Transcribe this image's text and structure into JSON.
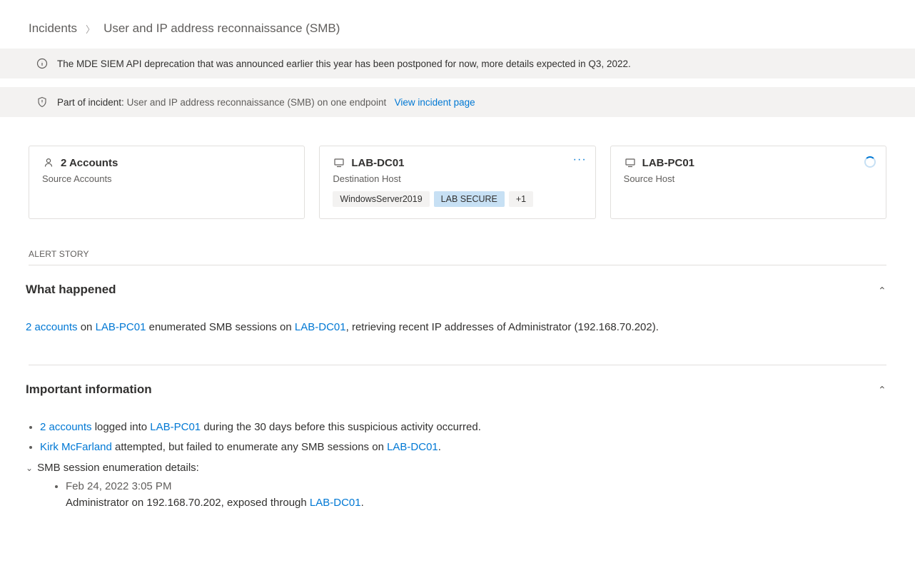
{
  "breadcrumb": {
    "root": "Incidents",
    "current": "User and IP address reconnaissance (SMB)"
  },
  "banners": {
    "deprecation": "The MDE SIEM API deprecation that was announced earlier this year has been postponed for now, more details expected in Q3, 2022.",
    "incident_prefix": "Part of incident:",
    "incident_text": "User and IP address reconnaissance (SMB) on one endpoint",
    "incident_link": "View incident page"
  },
  "cards": {
    "accounts": {
      "title": "2 Accounts",
      "subtitle": "Source Accounts"
    },
    "dest": {
      "title": "LAB-DC01",
      "subtitle": "Destination Host",
      "tag1": "WindowsServer2019",
      "tag2": "LAB SECURE",
      "tag3": "+1"
    },
    "source": {
      "title": "LAB-PC01",
      "subtitle": "Source Host"
    }
  },
  "alert_story_label": "ALERT STORY",
  "what_happened": {
    "heading": "What happened",
    "link_accounts": "2 accounts",
    "txt1": " on ",
    "link_srchost": "LAB-PC01",
    "txt2": " enumerated SMB sessions on ",
    "link_dsthost": "LAB-DC01",
    "txt3": ", retrieving recent IP addresses of Administrator (192.168.70.202)."
  },
  "important": {
    "heading": "Important information",
    "li1": {
      "link1": "2 accounts",
      "txt1": " logged into ",
      "link2": "LAB-PC01",
      "txt2": " during the 30 days before this suspicious activity occurred."
    },
    "li2": {
      "link1": "Kirk McFarland",
      "txt1": " attempted, but failed to enumerate any SMB sessions on ",
      "link2": "LAB-DC01",
      "txt2": "."
    },
    "expand_label": "SMB session enumeration details:",
    "sub_time": "Feb 24, 2022 3:05 PM",
    "sub_body_pre": "Administrator on 192.168.70.202, exposed through ",
    "sub_body_link": "LAB-DC01",
    "sub_body_post": "."
  }
}
